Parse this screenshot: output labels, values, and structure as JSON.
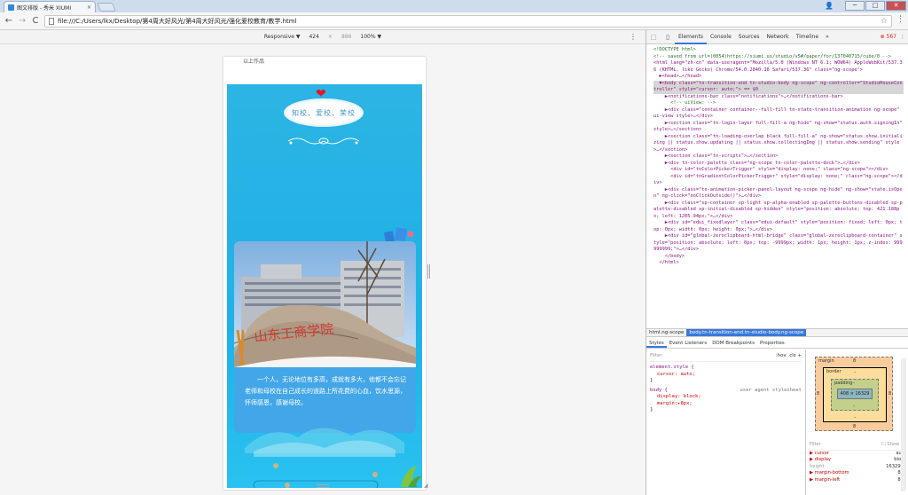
{
  "browser": {
    "tab_title": "图文排版 - 秀米 XIUMI",
    "tab_close": "×",
    "url": "file:///C:/Users/lkx/Desktop/第4周大好风光/第4周大好风光/强化爱校教育/教学.html",
    "back_glyph": "←",
    "forward_glyph": "→",
    "reload_glyph": "C",
    "star_glyph": "☆",
    "menu_glyph": "⋮",
    "min_glyph": "─",
    "max_glyph": "□",
    "close_glyph": "✕",
    "user_glyph": "👤"
  },
  "device_toolbar": {
    "mode": "Responsive ▼",
    "width": "424",
    "times": "×",
    "height": "886",
    "zoom": "100% ▼",
    "menu": "⋮"
  },
  "page": {
    "top_text": "以上作品",
    "motto": "知校、爱校、荣校",
    "caption": "一个人，无论地位有多高，成就有多大，他都不会忘记老师和母校在自己成长的道路上所花费的心血，饮水思源，怀师感恩，感谢母校。",
    "rock_text": "山东工商学院",
    "heart_glyph": "❤"
  },
  "devtools": {
    "tabs": [
      "Elements",
      "Console",
      "Sources",
      "Network",
      "Timeline"
    ],
    "more": "»",
    "errors": "⊗ 567",
    "kebab": "⋮",
    "dom_lines": [
      {
        "text": "<!DOCTYPE html>",
        "type": "comment"
      },
      {
        "text": "<!-- saved from url=(0054)https://xiumi.us/studio/v5#/paper/for/137040715/cube/0 -->",
        "type": "comment"
      },
      {
        "text": "<html lang=\"zh-cn\" data-useragent=\"Mozilla/5.0 (Windows NT 6.1; WOW64) AppleWebKit/537.36 (KHTML, like Gecko) Chrome/54.0.2840.16 Safari/537.36\" class=\"ng-scope\">",
        "type": "tag"
      },
      {
        "text": "  ▶<head>…</head>",
        "type": "tag"
      },
      {
        "text": "  ▼<body class=\"tn-transition-end tn-studio-body ng-scope\" ng-controller=\"StudioHouseController\" style=\"cursor: auto;\"> == $0",
        "type": "selected"
      },
      {
        "text": "    ▶<notifications-bar class=\"notifications\">…</notifications-bar>",
        "type": "tag"
      },
      {
        "text": "      <!-- uiView: -->",
        "type": "comment"
      },
      {
        "text": "    ▶<div class=\"container container--full-fill tn-state-transition-animation ng-scope\" ui-view style>…</div>",
        "type": "tag"
      },
      {
        "text": "    ▶<section class=\"tn-login-layer full-fill-a ng-hide\" ng-show=\"status.auth.signingIn\" style>…</section>",
        "type": "tag"
      },
      {
        "text": "    ▶<section class=\"tn-loading-overlap black full-fill-a\" ng-show=\"status.show.initializing || status.show.updating || status.show.collectingImg || status.show.sending\" style>…</section>",
        "type": "tag"
      },
      {
        "text": "    ▶<section class=\"tn-scripts\">…</section>",
        "type": "tag"
      },
      {
        "text": "    ▶<div tn-color-palette class=\"ng-scope tn-color-palette-dock\">…</div>",
        "type": "tag"
      },
      {
        "text": "      <div id=\"tnColorPickerTrigger\" style=\"display: none;\" class=\"ng-scope\"></div>",
        "type": "tag"
      },
      {
        "text": "      <div id=\"tnGradientColorPickerTrigger\" style=\"display: none;\" class=\"ng-scope\"></div>",
        "type": "tag"
      },
      {
        "text": "    ▶<div class=\"tn-animation-picker-panel-layout ng-scope ng-hide\" ng-show=\"state.isOpen\" ng-click=\"onClickOutside()\">…</div>",
        "type": "tag"
      },
      {
        "text": "    ▶<div class=\"sp-container sp-light sp-alpha-enabled sp-palette-buttons-disabled sp-palette-disabled sp-initial-disabled sp-hidden\" style=\"position: absolute; top: 421.188px; left: 1205.94px;\">…</div>",
        "type": "tag"
      },
      {
        "text": "    ▶<div id=\"edui_fixedlayer\" class=\"edui-default\" style=\"position: fixed; left: 0px; top: 0px; width: 0px; height: 0px;\">…</div>",
        "type": "tag"
      },
      {
        "text": "    ▶<div id=\"global-zeroclipboard-html-bridge\" class=\"global-zeroclipboard-container\" style=\"position: absolute; left: 0px; top: -9999px; width: 1px; height: 1px; z-index: 999999999;\">…</div>",
        "type": "tag"
      },
      {
        "text": "    </body>",
        "type": "tag"
      },
      {
        "text": "  </html>",
        "type": "tag"
      }
    ],
    "breadcrumbs": [
      "html.ng-scope",
      "body.tn-transition-end.tn-studio-body.ng-scope"
    ],
    "subtabs": [
      "Styles",
      "Event Listeners",
      "DOM Breakpoints",
      "Properties"
    ],
    "styles": {
      "filter": "Filter",
      "hov": ":hov  .cls  +",
      "rule1_sel": "element.style {",
      "rule1_prop": "cursor: auto;",
      "rule1_end": "}",
      "rule2_sel": "body {",
      "rule2_ua": "user agent stylesheet",
      "rule2_prop1": "display: block;",
      "rule2_prop2": "margin:▸8px;",
      "rule2_end": "}"
    },
    "box_model": {
      "margin_label": "margin",
      "margin_val": "8",
      "border_label": "border",
      "border_val": "–",
      "padding_label": "padding–",
      "content": "408 × 16329",
      "left_val": "8",
      "right_val": "8",
      "bottom_val": "8",
      "padding_bottom": "–",
      "border_bottom": "–"
    },
    "computed": {
      "filter": "Filter",
      "show_all": "☐ Show all",
      "rows": [
        {
          "k": "▶ cursor",
          "v": "auto",
          "dim": false
        },
        {
          "k": "▶ display",
          "v": "block",
          "dim": false
        },
        {
          "k": "  height",
          "v": "16329px",
          "dim": true
        },
        {
          "k": "▶ margin-bottom",
          "v": "8px",
          "dim": false
        },
        {
          "k": "▶ margin-left",
          "v": "8px",
          "dim": false
        }
      ]
    }
  }
}
